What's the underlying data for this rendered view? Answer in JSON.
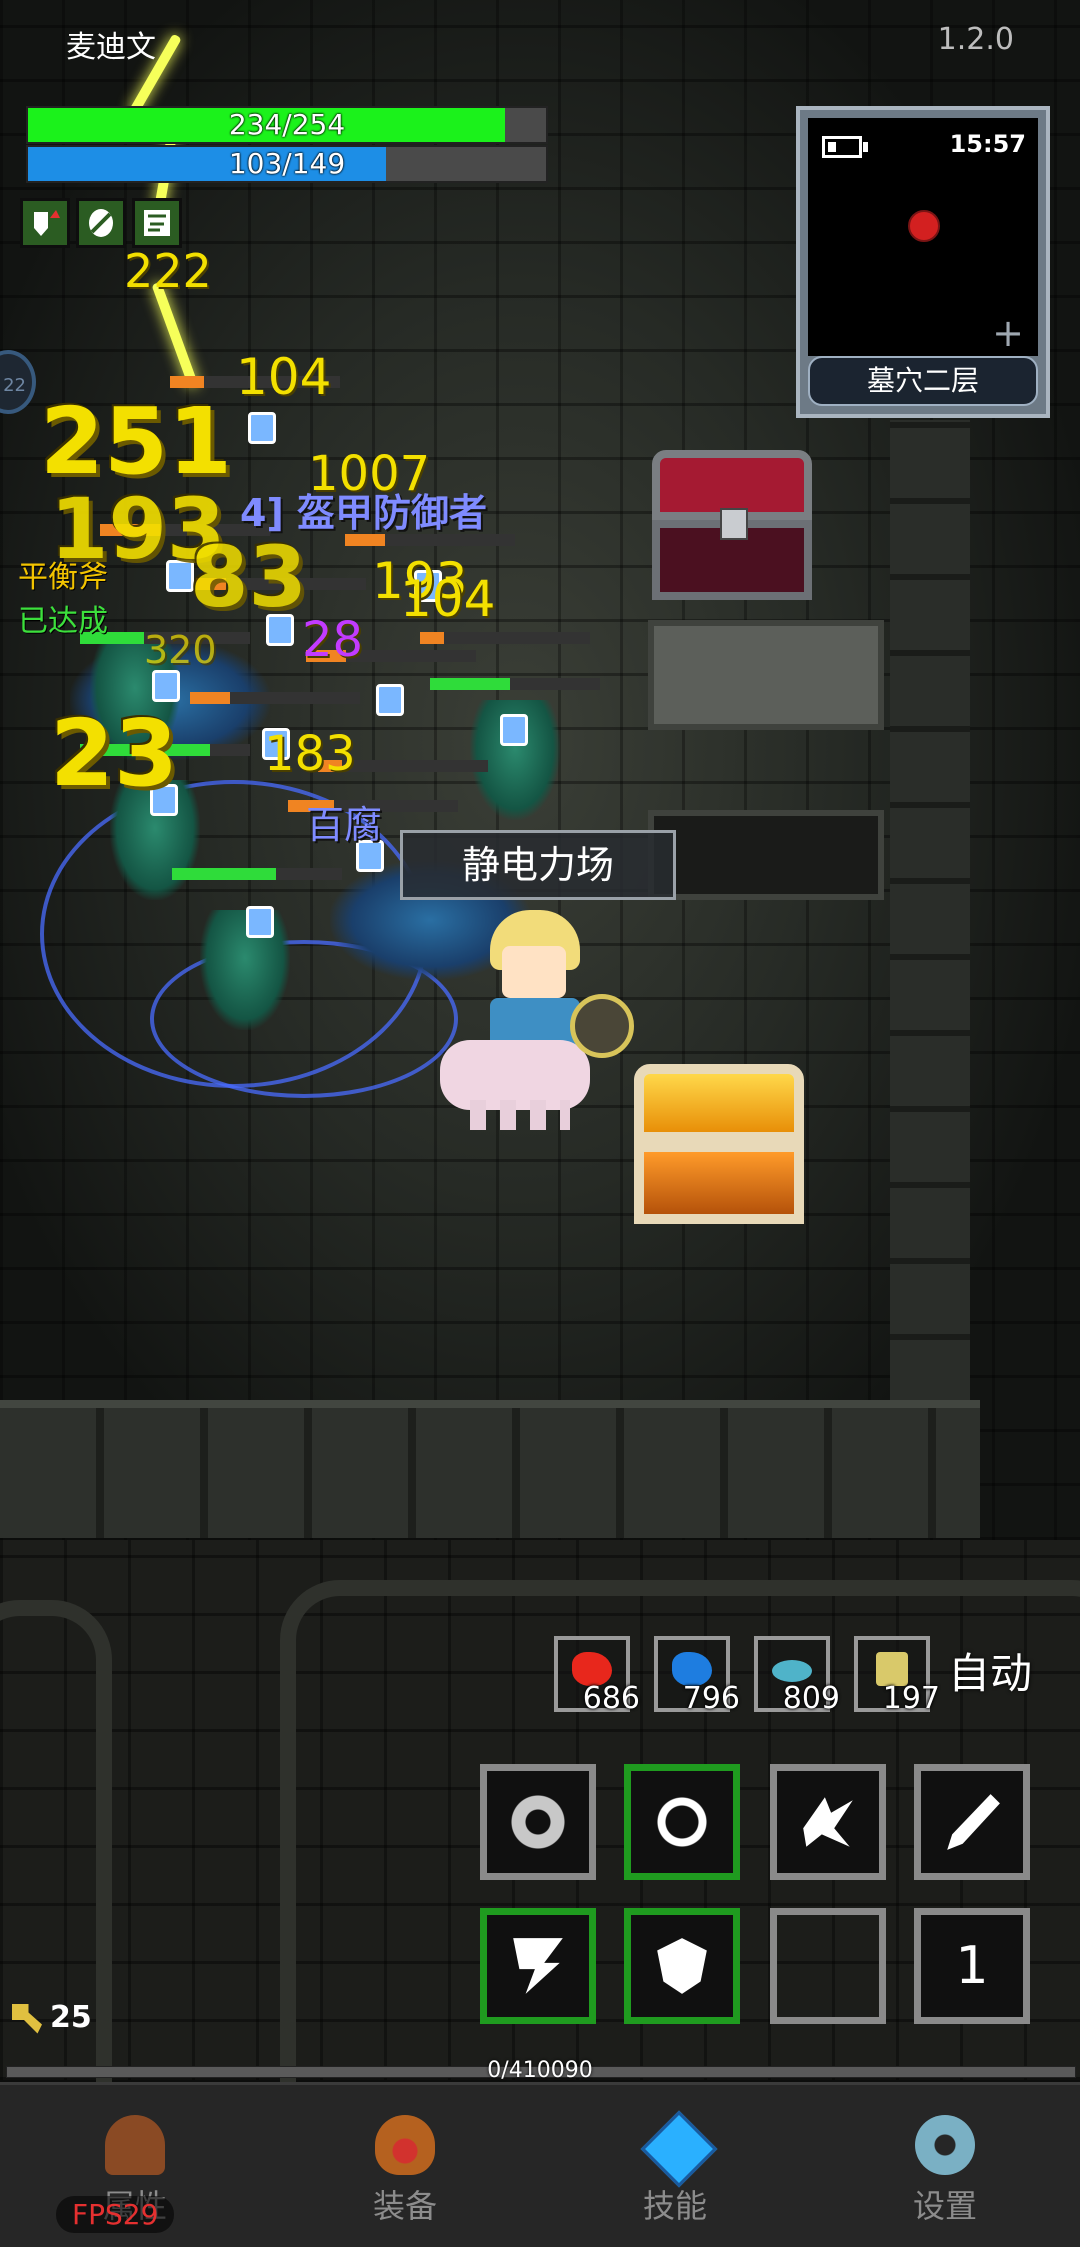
{
  "hud": {
    "player_name": "麦迪文",
    "version": "1.2.0",
    "hp": {
      "text": "234/254",
      "current": 234,
      "max": 254,
      "color": "#1bf21b"
    },
    "mp": {
      "text": "103/149",
      "current": 103,
      "max": 149,
      "color": "#1d8ee6"
    },
    "buffs": [
      "shield-up-buff-icon",
      "armor-buff-icon",
      "map-buff-icon"
    ]
  },
  "minimap": {
    "time": "15:57",
    "floor_name": "墓穴二层",
    "left_tab_number": "22"
  },
  "battle": {
    "skill_popup": "静电力场",
    "damage_numbers": [
      "222",
      "104",
      "251",
      "1007",
      "193",
      "83",
      "193",
      "104",
      "28",
      "320",
      "23",
      "183"
    ],
    "blue_text_1": "4] 盔甲防御者",
    "blue_text_2": "百腐",
    "status_yellow": "平衡斧",
    "status_green": "已达成"
  },
  "consumables": [
    {
      "name": "red-potion",
      "count": "686",
      "color": "#e8271c"
    },
    {
      "name": "blue-potion",
      "count": "796",
      "color": "#1e7de0"
    },
    {
      "name": "fish",
      "count": "809",
      "color": "#4fb3c9"
    },
    {
      "name": "scroll",
      "count": "197",
      "color": "#d9c96a"
    }
  ],
  "auto_label": "自动",
  "skills": [
    {
      "name": "skill-gear",
      "state": "inactive"
    },
    {
      "name": "skill-clock",
      "state": "active"
    },
    {
      "name": "skill-burst",
      "state": "inactive"
    },
    {
      "name": "skill-spear",
      "state": "inactive"
    },
    {
      "name": "skill-lightning",
      "state": "active"
    },
    {
      "name": "skill-shield",
      "state": "active"
    },
    {
      "name": "skill-empty",
      "state": "empty"
    },
    {
      "name": "skill-slot-number",
      "state": "number",
      "label": "1"
    }
  ],
  "keys": "25",
  "exp": {
    "text": "0/410090",
    "current": 0,
    "max": 410090
  },
  "nav": [
    {
      "label": "属性",
      "icon": "helmet-icon"
    },
    {
      "label": "装备",
      "icon": "bag-icon"
    },
    {
      "label": "技能",
      "icon": "gem-icon"
    },
    {
      "label": "设置",
      "icon": "gear-icon"
    }
  ],
  "fps": "FPS29"
}
